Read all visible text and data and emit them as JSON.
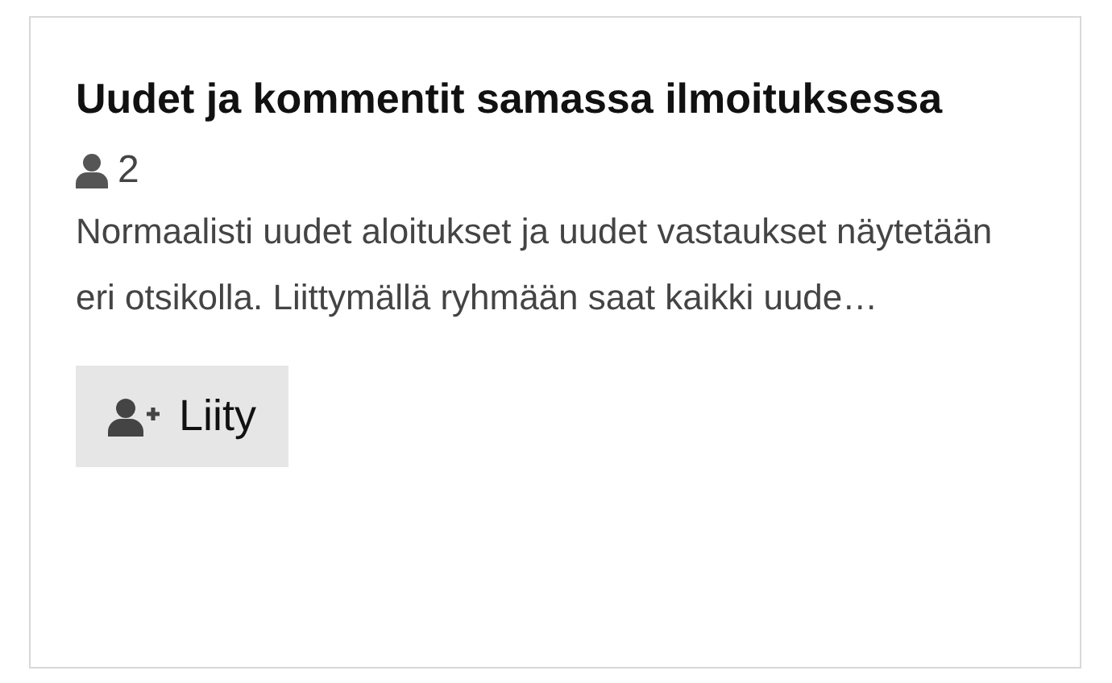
{
  "card": {
    "title": "Uudet ja kommentit samassa ilmoituksessa",
    "member_count": "2",
    "description": "Normaalisti uudet aloitukset ja uudet vastaukset näytetään eri otsikolla. Liittymällä ryhmään saat kaikki uude…",
    "join_button": "Liity"
  }
}
